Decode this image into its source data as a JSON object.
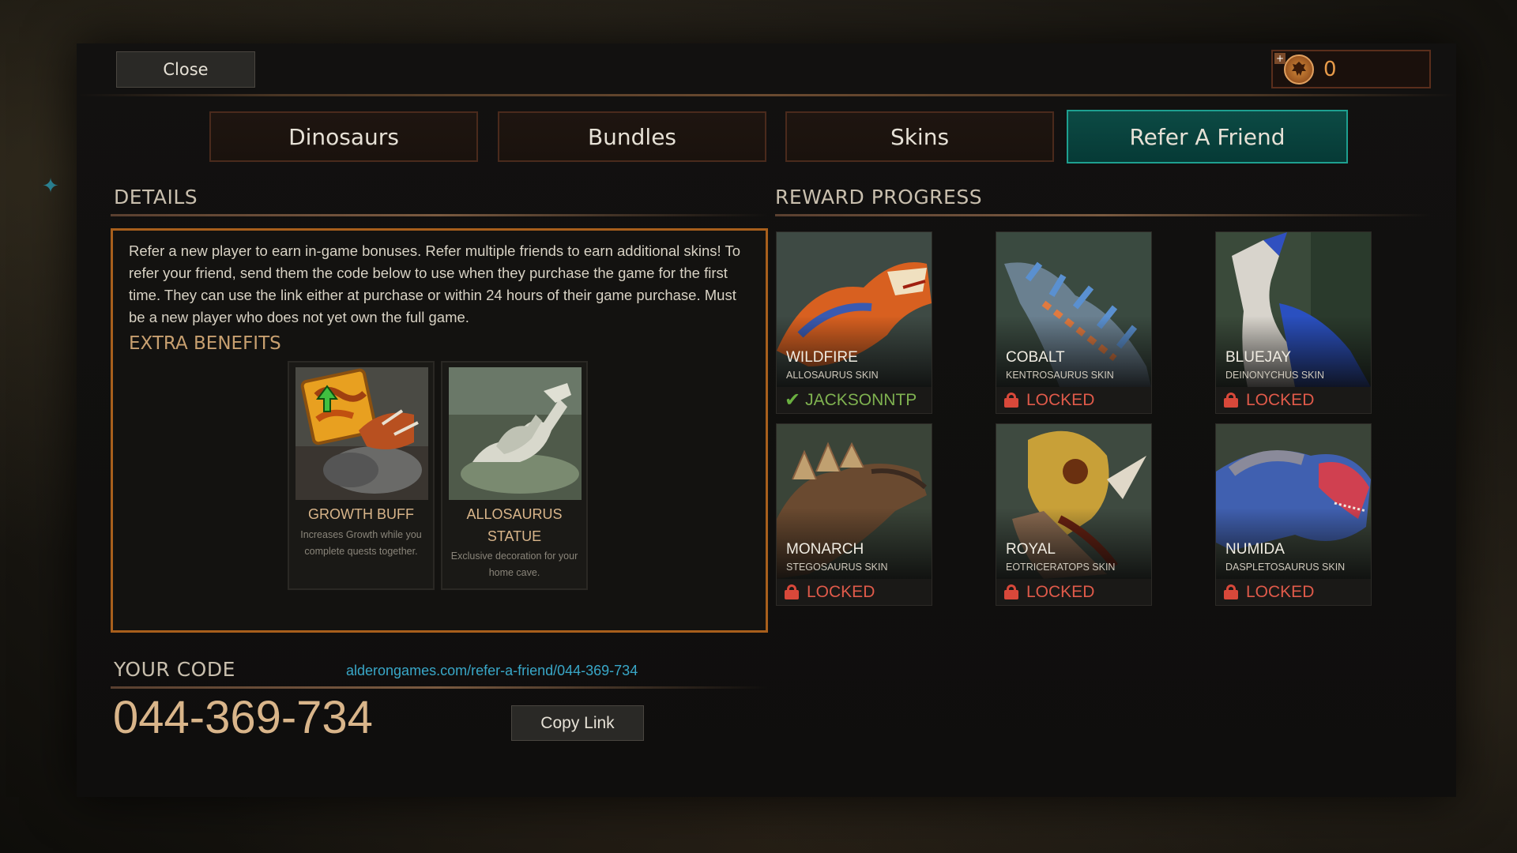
{
  "header": {
    "close_label": "Close",
    "currency_plus": "+",
    "currency_amount": "0",
    "currency_icon": "dinosaur-coin-icon"
  },
  "tabs": [
    {
      "label": "Dinosaurs",
      "active": false
    },
    {
      "label": "Bundles",
      "active": false
    },
    {
      "label": "Skins",
      "active": false
    },
    {
      "label": "Refer A Friend",
      "active": true
    }
  ],
  "details": {
    "title": "DETAILS",
    "body": "Refer a new player to earn in-game bonuses. Refer multiple friends to earn additional skins! To refer your friend, send them the code below to use when they purchase the game for the first time. They can use the link either at purchase or within 24 hours of their game purchase. Must be a new player who does not yet own the full game.",
    "extra_benefits_title": "EXTRA BENEFITS",
    "benefits": [
      {
        "name": "GROWTH BUFF",
        "desc": "Increases Growth while you complete quests together."
      },
      {
        "name": "ALLOSAURUS STATUE",
        "desc": "Exclusive decoration for your home cave."
      }
    ]
  },
  "reward_progress": {
    "title": "REWARD PROGRESS",
    "rewards": [
      {
        "name": "WILDFIRE",
        "skin": "ALLOSAURUS SKIN",
        "status": "JACKSONNTP",
        "unlocked": true
      },
      {
        "name": "COBALT",
        "skin": "KENTROSAURUS SKIN",
        "status": "LOCKED",
        "unlocked": false
      },
      {
        "name": "BLUEJAY",
        "skin": "DEINONYCHUS SKIN",
        "status": "LOCKED",
        "unlocked": false
      },
      {
        "name": "MONARCH",
        "skin": "STEGOSAURUS SKIN",
        "status": "LOCKED",
        "unlocked": false
      },
      {
        "name": "ROYAL",
        "skin": "EOTRICERATOPS SKIN",
        "status": "LOCKED",
        "unlocked": false
      },
      {
        "name": "NUMIDA",
        "skin": "DASPLETOSAURUS SKIN",
        "status": "LOCKED",
        "unlocked": false
      }
    ]
  },
  "your_code": {
    "title": "YOUR CODE",
    "link": "alderongames.com/refer-a-friend/044-369-734",
    "code": "044-369-734",
    "copy_label": "Copy Link"
  },
  "colors": {
    "accent_teal": "#0c4a44",
    "accent_orange": "#a85f1c",
    "locked_red": "#e05a4a",
    "unlocked_green": "#7fb250",
    "link_blue": "#39a7c8"
  }
}
